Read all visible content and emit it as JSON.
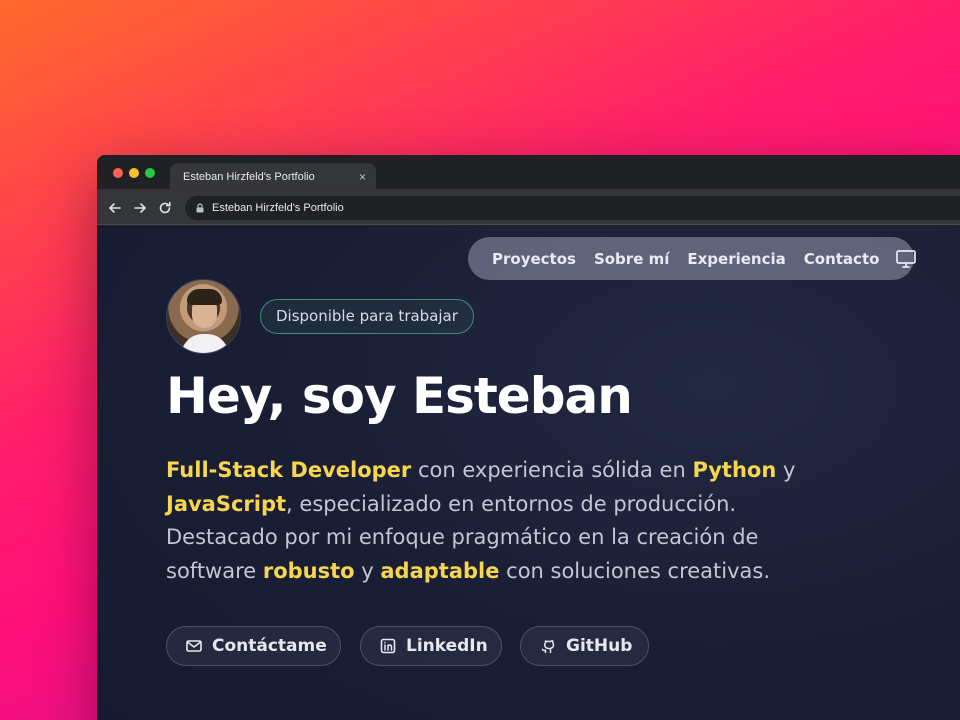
{
  "browser": {
    "tab_title": "Esteban Hirzfeld's Portfolio",
    "tab_close": "×",
    "address": "Esteban Hirzfeld's Portfolio"
  },
  "nav": {
    "items": [
      "Proyectos",
      "Sobre mí",
      "Experiencia",
      "Contacto"
    ]
  },
  "hero": {
    "status_badge": "Disponible para trabajar",
    "title": "Hey, soy Esteban",
    "description": {
      "p1": "Full-Stack Developer",
      "p2": " con experiencia sólida en ",
      "p3": "Python",
      "p4": " y ",
      "p5": "JavaScript",
      "p6": ", especializado en entornos de producción. Destacado por mi enfoque pragmático en la creación de software ",
      "p7": "robusto",
      "p8": " y ",
      "p9": "adaptable",
      "p10": " con soluciones creativas."
    }
  },
  "buttons": {
    "contact": "Contáctame",
    "linkedin": "LinkedIn",
    "github": "GitHub"
  },
  "colors": {
    "highlight": "#f6d64e",
    "background": "#1b1f36",
    "badge_border": "#3b8f7f"
  },
  "icons": {
    "nav_theme": "monitor-icon",
    "contact": "mail-icon",
    "linkedin": "linkedin-icon",
    "github": "github-icon"
  }
}
